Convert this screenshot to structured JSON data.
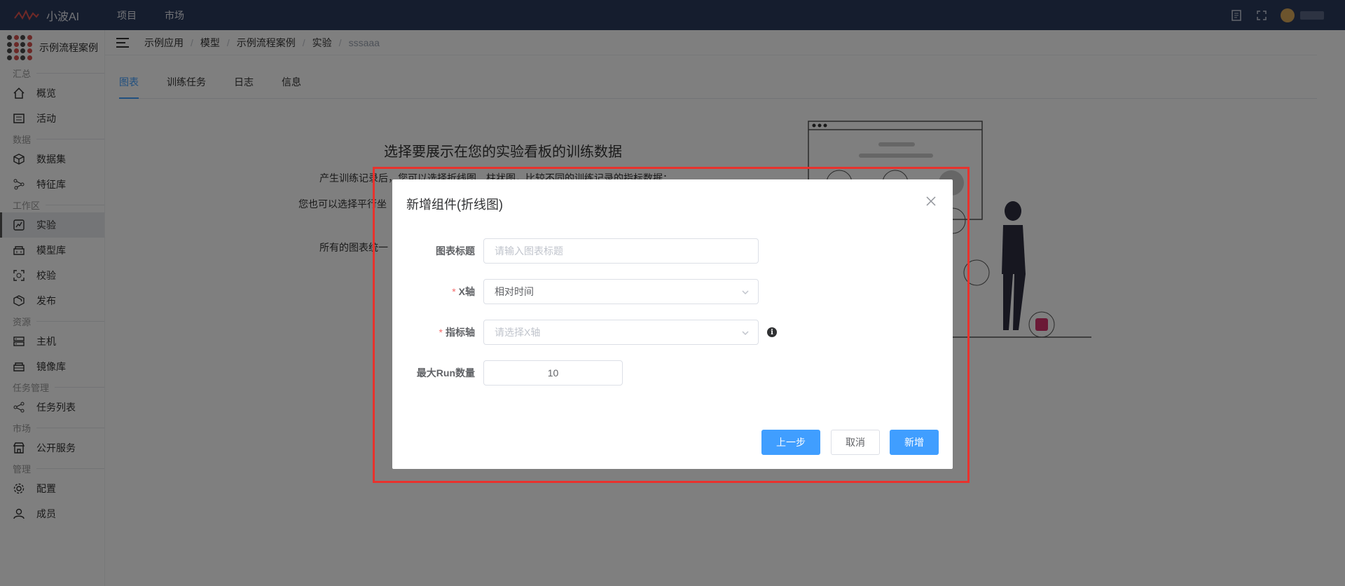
{
  "topbar": {
    "app_name": "小波AI",
    "nav": [
      "项目",
      "市场"
    ]
  },
  "sidebar": {
    "project_name": "示例流程案例",
    "groups": [
      {
        "title": "汇总",
        "items": [
          {
            "label": "概览",
            "icon": "home-icon"
          },
          {
            "label": "活动",
            "icon": "activity-icon"
          }
        ]
      },
      {
        "title": "数据",
        "items": [
          {
            "label": "数据集",
            "icon": "cube-icon"
          },
          {
            "label": "特征库",
            "icon": "feature-icon"
          }
        ]
      },
      {
        "title": "工作区",
        "items": [
          {
            "label": "实验",
            "icon": "experiment-icon",
            "active": true
          },
          {
            "label": "模型库",
            "icon": "model-icon"
          },
          {
            "label": "校验",
            "icon": "scan-icon"
          },
          {
            "label": "发布",
            "icon": "package-icon"
          }
        ]
      },
      {
        "title": "资源",
        "items": [
          {
            "label": "主机",
            "icon": "server-icon"
          },
          {
            "label": "镜像库",
            "icon": "image-repo-icon"
          }
        ]
      },
      {
        "title": "任务管理",
        "items": [
          {
            "label": "任务列表",
            "icon": "task-icon"
          }
        ]
      },
      {
        "title": "市场",
        "items": [
          {
            "label": "公开服务",
            "icon": "store-icon"
          }
        ]
      },
      {
        "title": "管理",
        "items": [
          {
            "label": "配置",
            "icon": "gear-icon"
          },
          {
            "label": "成员",
            "icon": "user-icon"
          }
        ]
      }
    ]
  },
  "breadcrumbs": [
    "示例应用",
    "模型",
    "示例流程案例",
    "实验",
    "sssaaa"
  ],
  "tabs": [
    "图表",
    "训练任务",
    "日志",
    "信息"
  ],
  "intro": {
    "title": "选择要展示在您的实验看板的训练数据",
    "line1": "产生训练记录后，您可以选择折线图、柱状图，比较不同的训练记录的指标数据；",
    "line2": "您也可以选择平行坐",
    "line3": "所有的图表统一"
  },
  "modal": {
    "title": "新增组件(折线图)",
    "fields": {
      "chart_title": {
        "label": "图表标题",
        "placeholder": "请输入图表标题"
      },
      "x_axis": {
        "label": "X轴",
        "value": "相对时间"
      },
      "metric_axis": {
        "label": "指标轴",
        "placeholder": "请选择X轴"
      },
      "max_runs": {
        "label": "最大Run数量",
        "value": "10"
      }
    },
    "buttons": {
      "prev": "上一步",
      "cancel": "取消",
      "add": "新增"
    }
  },
  "colors": {
    "topbar": "#2b3a5c",
    "accent": "#409eff",
    "highlight": "#e8322d",
    "required": "#f56c6c"
  }
}
